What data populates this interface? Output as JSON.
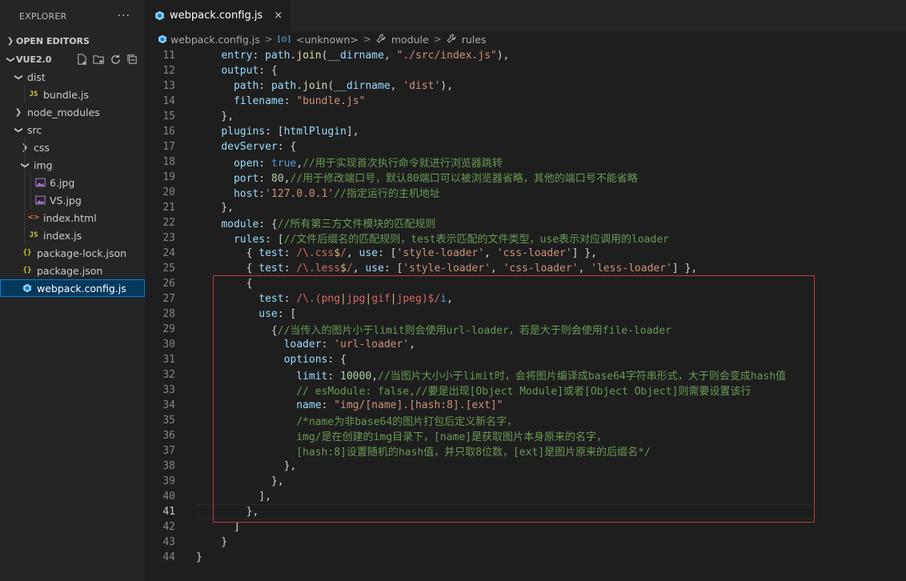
{
  "sidebar": {
    "title": "EXPLORER",
    "more_icon": "ellipsis-icon",
    "open_editors_label": "OPEN EDITORS",
    "project_label": "VUE2.0",
    "tree": [
      {
        "label": "dist",
        "kind": "folder",
        "expanded": true,
        "depth": 1
      },
      {
        "label": "bundle.js",
        "kind": "js",
        "depth": 2
      },
      {
        "label": "node_modules",
        "kind": "folder",
        "expanded": false,
        "depth": 1
      },
      {
        "label": "src",
        "kind": "folder",
        "expanded": true,
        "depth": 1
      },
      {
        "label": "css",
        "kind": "folder",
        "expanded": false,
        "depth": 2
      },
      {
        "label": "img",
        "kind": "folder",
        "expanded": true,
        "depth": 2
      },
      {
        "label": "6.jpg",
        "kind": "image",
        "depth": 3
      },
      {
        "label": "VS.jpg",
        "kind": "image",
        "depth": 3
      },
      {
        "label": "index.html",
        "kind": "html",
        "depth": 2
      },
      {
        "label": "index.js",
        "kind": "js",
        "depth": 2
      },
      {
        "label": "package-lock.json",
        "kind": "json",
        "depth": 1
      },
      {
        "label": "package.json",
        "kind": "json",
        "depth": 1
      },
      {
        "label": "webpack.config.js",
        "kind": "webpack",
        "depth": 1,
        "selected": true
      }
    ]
  },
  "tab": {
    "label": "webpack.config.js",
    "close": "×"
  },
  "breadcrumb": {
    "file": "webpack.config.js",
    "items": [
      {
        "icon": "[⊙]",
        "label": "<unknown>"
      },
      {
        "icon": "🔧",
        "label": "module"
      },
      {
        "icon": "🔧",
        "label": "rules"
      }
    ],
    "separator": ">"
  },
  "code": {
    "current_line": 41,
    "lines": [
      {
        "n": 11,
        "tokens": [
          [
            "    ",
            "p"
          ],
          [
            "entry",
            "k"
          ],
          [
            ": ",
            "p"
          ],
          [
            "path",
            "k"
          ],
          [
            ".",
            "p"
          ],
          [
            "join",
            "f"
          ],
          [
            "(",
            "p"
          ],
          [
            "__dirname",
            "k"
          ],
          [
            ", ",
            "p"
          ],
          [
            "\"./src/index.js\"",
            "s"
          ],
          [
            "),",
            "p"
          ]
        ]
      },
      {
        "n": 12,
        "tokens": [
          [
            "    ",
            "p"
          ],
          [
            "output",
            "k"
          ],
          [
            ": {",
            "p"
          ]
        ]
      },
      {
        "n": 13,
        "tokens": [
          [
            "      ",
            "p"
          ],
          [
            "path",
            "k"
          ],
          [
            ": ",
            "p"
          ],
          [
            "path",
            "k"
          ],
          [
            ".",
            "p"
          ],
          [
            "join",
            "f"
          ],
          [
            "(",
            "p"
          ],
          [
            "__dirname",
            "k"
          ],
          [
            ", ",
            "p"
          ],
          [
            "'dist'",
            "s"
          ],
          [
            "),",
            "p"
          ]
        ]
      },
      {
        "n": 14,
        "tokens": [
          [
            "      ",
            "p"
          ],
          [
            "filename",
            "k"
          ],
          [
            ": ",
            "p"
          ],
          [
            "\"bundle.js\"",
            "s"
          ]
        ]
      },
      {
        "n": 15,
        "tokens": [
          [
            "    },",
            "p"
          ]
        ]
      },
      {
        "n": 16,
        "tokens": [
          [
            "    ",
            "p"
          ],
          [
            "plugins",
            "k"
          ],
          [
            ": [",
            "p"
          ],
          [
            "htmlPlugin",
            "k"
          ],
          [
            "],",
            "p"
          ]
        ]
      },
      {
        "n": 17,
        "tokens": [
          [
            "    ",
            "p"
          ],
          [
            "devServer",
            "k"
          ],
          [
            ": {",
            "p"
          ]
        ]
      },
      {
        "n": 18,
        "tokens": [
          [
            "      ",
            "p"
          ],
          [
            "open",
            "k"
          ],
          [
            ": ",
            "p"
          ],
          [
            "true",
            "b"
          ],
          [
            ",",
            "p"
          ],
          [
            "//用于实现首次执行命令就进行浏览器跳转",
            "c"
          ]
        ]
      },
      {
        "n": 19,
        "tokens": [
          [
            "      ",
            "p"
          ],
          [
            "port",
            "k"
          ],
          [
            ": ",
            "p"
          ],
          [
            "80",
            "n"
          ],
          [
            ",",
            "p"
          ],
          [
            "//用于修改端口号，默认80端口可以被浏览器省略，其他的端口号不能省略",
            "c"
          ]
        ]
      },
      {
        "n": 20,
        "tokens": [
          [
            "      ",
            "p"
          ],
          [
            "host",
            "k"
          ],
          [
            ":",
            "p"
          ],
          [
            "'127.0.0.1'",
            "s"
          ],
          [
            "//指定运行的主机地址",
            "c"
          ]
        ]
      },
      {
        "n": 21,
        "tokens": [
          [
            "    },",
            "p"
          ]
        ]
      },
      {
        "n": 22,
        "tokens": [
          [
            "    ",
            "p"
          ],
          [
            "module",
            "k"
          ],
          [
            ": {",
            "p"
          ],
          [
            "//所有第三方文件模块的匹配规则",
            "c"
          ]
        ]
      },
      {
        "n": 23,
        "tokens": [
          [
            "      ",
            "p"
          ],
          [
            "rules",
            "k"
          ],
          [
            ": [",
            "p"
          ],
          [
            "//文件后缀名的匹配规则，test表示匹配的文件类型，use表示对应调用的loader",
            "c"
          ]
        ]
      },
      {
        "n": 24,
        "tokens": [
          [
            "        { ",
            "p"
          ],
          [
            "test",
            "k"
          ],
          [
            ": ",
            "p"
          ],
          [
            "/\\.",
            "r"
          ],
          [
            "css",
            "r"
          ],
          [
            "$",
            "t"
          ],
          [
            "/",
            "r"
          ],
          [
            ", ",
            "p"
          ],
          [
            "use",
            "k"
          ],
          [
            ": [",
            "p"
          ],
          [
            "'style-loader'",
            "s"
          ],
          [
            ", ",
            "p"
          ],
          [
            "'css-loader'",
            "s"
          ],
          [
            "] },",
            "p"
          ]
        ]
      },
      {
        "n": 25,
        "tokens": [
          [
            "        { ",
            "p"
          ],
          [
            "test",
            "k"
          ],
          [
            ": ",
            "p"
          ],
          [
            "/\\.",
            "r"
          ],
          [
            "less",
            "r"
          ],
          [
            "$",
            "t"
          ],
          [
            "/",
            "r"
          ],
          [
            ", ",
            "p"
          ],
          [
            "use",
            "k"
          ],
          [
            ": [",
            "p"
          ],
          [
            "'style-loader'",
            "s"
          ],
          [
            ", ",
            "p"
          ],
          [
            "'css-loader'",
            "s"
          ],
          [
            ", ",
            "p"
          ],
          [
            "'less-loader'",
            "s"
          ],
          [
            "] },",
            "p"
          ]
        ]
      },
      {
        "n": 26,
        "tokens": [
          [
            "        {",
            "p"
          ]
        ]
      },
      {
        "n": 27,
        "tokens": [
          [
            "          ",
            "p"
          ],
          [
            "test",
            "k"
          ],
          [
            ": ",
            "p"
          ],
          [
            "/\\.(",
            "r"
          ],
          [
            "png",
            "r"
          ],
          [
            "|",
            "t"
          ],
          [
            "jpg",
            "r"
          ],
          [
            "|",
            "t"
          ],
          [
            "gif",
            "r"
          ],
          [
            "|",
            "t"
          ],
          [
            "jpeg",
            "r"
          ],
          [
            ")$/",
            "r"
          ],
          [
            "i",
            "b"
          ],
          [
            ",",
            "p"
          ]
        ]
      },
      {
        "n": 28,
        "tokens": [
          [
            "          ",
            "p"
          ],
          [
            "use",
            "k"
          ],
          [
            ": [",
            "p"
          ]
        ]
      },
      {
        "n": 29,
        "tokens": [
          [
            "            {",
            "p"
          ],
          [
            "//当传入的图片小于limit则会使用url-loader，若是大于则会使用file-loader",
            "c"
          ]
        ]
      },
      {
        "n": 30,
        "tokens": [
          [
            "              ",
            "p"
          ],
          [
            "loader",
            "k"
          ],
          [
            ": ",
            "p"
          ],
          [
            "'url-loader'",
            "s"
          ],
          [
            ",",
            "p"
          ]
        ]
      },
      {
        "n": 31,
        "tokens": [
          [
            "              ",
            "p"
          ],
          [
            "options",
            "k"
          ],
          [
            ": {",
            "p"
          ]
        ]
      },
      {
        "n": 32,
        "tokens": [
          [
            "                ",
            "p"
          ],
          [
            "limit",
            "k"
          ],
          [
            ": ",
            "p"
          ],
          [
            "10000",
            "n"
          ],
          [
            ",",
            "p"
          ],
          [
            "//当图片大小小于limit时，会将图片编译成base64字符串形式，大于则会变成hash值",
            "c"
          ]
        ]
      },
      {
        "n": 33,
        "tokens": [
          [
            "                ",
            "p"
          ],
          [
            "// esModule: false,//要是出现[Object Module]或者[Object Object]则需要设置该行",
            "c"
          ]
        ]
      },
      {
        "n": 34,
        "tokens": [
          [
            "                ",
            "p"
          ],
          [
            "name",
            "k"
          ],
          [
            ": ",
            "p"
          ],
          [
            "\"img/[name].[hash:8].[ext]\"",
            "s"
          ]
        ]
      },
      {
        "n": 35,
        "tokens": [
          [
            "                ",
            "p"
          ],
          [
            "/*name为非base64的图片打包后定义新名字，",
            "c"
          ]
        ]
      },
      {
        "n": 36,
        "tokens": [
          [
            "                ",
            "p"
          ],
          [
            "img/是在创建的img目录下，[name]是获取图片本身原来的名字，",
            "c"
          ]
        ]
      },
      {
        "n": 37,
        "tokens": [
          [
            "                ",
            "p"
          ],
          [
            "[hash:8]设置随机的hash值，并只取8位数，[ext]是图片原来的后缀名*/",
            "c"
          ]
        ]
      },
      {
        "n": 38,
        "tokens": [
          [
            "              },",
            "p"
          ]
        ]
      },
      {
        "n": 39,
        "tokens": [
          [
            "            },",
            "p"
          ]
        ]
      },
      {
        "n": 40,
        "tokens": [
          [
            "          ],",
            "p"
          ]
        ]
      },
      {
        "n": 41,
        "tokens": [
          [
            "        },",
            "p"
          ]
        ]
      },
      {
        "n": 42,
        "tokens": [
          [
            "      ]",
            "p"
          ]
        ]
      },
      {
        "n": 43,
        "tokens": [
          [
            "    }",
            "p"
          ]
        ]
      },
      {
        "n": 44,
        "tokens": [
          [
            "}",
            "p"
          ]
        ]
      }
    ]
  },
  "colors": {
    "accent": "#007fd4",
    "highlight_border": "#c33a3a",
    "selection": "#04395e"
  }
}
